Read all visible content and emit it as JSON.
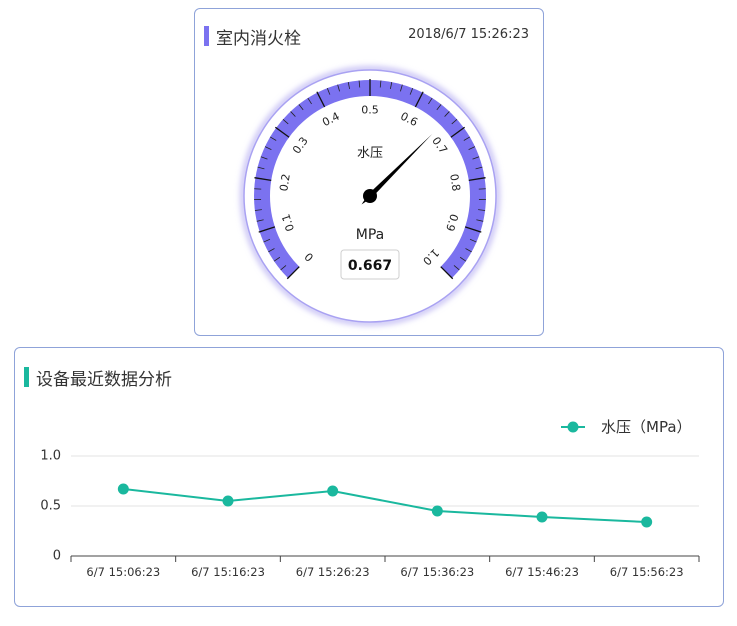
{
  "gauge_panel": {
    "title": "室内消火栓",
    "timestamp": "2018/6/7 15:26:23",
    "accent_color": "#7b72f0",
    "gauge": {
      "label": "水压",
      "unit": "MPa",
      "value": 0.667,
      "value_text": "0.667",
      "min": 0,
      "max": 1.0,
      "ticks": [
        "0",
        "0.1",
        "0.2",
        "0.3",
        "0.4",
        "0.5",
        "0.6",
        "0.7",
        "0.8",
        "0.9",
        "1.0"
      ],
      "arc_color": "#7b72f0"
    }
  },
  "chart_panel": {
    "title": "设备最近数据分析",
    "accent_color": "#1ab89e"
  },
  "chart_data": {
    "type": "line",
    "categories": [
      "6/7 15:06:23",
      "6/7 15:16:23",
      "6/7 15:26:23",
      "6/7 15:36:23",
      "6/7 15:46:23",
      "6/7 15:56:23"
    ],
    "series": [
      {
        "name": "水压（MPa）",
        "values": [
          0.67,
          0.55,
          0.65,
          0.45,
          0.39,
          0.34
        ],
        "color": "#1ab89e"
      }
    ],
    "ylim": [
      0,
      1.0
    ],
    "yticks": [
      "0",
      "0.5",
      "1.0"
    ],
    "legend_position": "top-right",
    "grid": true
  }
}
